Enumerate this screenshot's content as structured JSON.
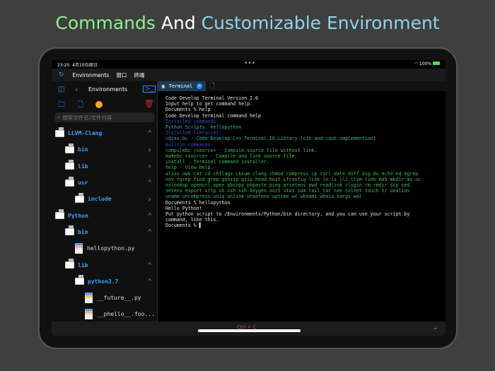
{
  "headline": {
    "part1": "Commands",
    "part2": "And",
    "part3": "Customizable Environment"
  },
  "status": {
    "time": "23:20",
    "date": "4月10日周日",
    "battery": "100%"
  },
  "menu": {
    "items": [
      "Environments",
      "窗口",
      "终端"
    ]
  },
  "sidebar": {
    "title": "Environments",
    "search_placeholder": "搜索文件名/文件内容",
    "tree": [
      {
        "name": "LLVM-Clang",
        "type": "dir",
        "level": 0,
        "chevron": "up"
      },
      {
        "name": "bin",
        "type": "dir",
        "level": 1,
        "chevron": "right"
      },
      {
        "name": "lib",
        "type": "dir",
        "level": 1,
        "chevron": "right"
      },
      {
        "name": "usr",
        "type": "dir",
        "level": 1,
        "chevron": "up"
      },
      {
        "name": "include",
        "type": "dir",
        "level": 2,
        "chevron": "right"
      },
      {
        "name": "Python",
        "type": "dir",
        "level": 0,
        "chevron": "up"
      },
      {
        "name": "bin",
        "type": "dir",
        "level": 1,
        "chevron": "up"
      },
      {
        "name": "hellopython.py",
        "type": "file",
        "level": 2
      },
      {
        "name": "lib",
        "type": "dir",
        "level": 1,
        "chevron": "up"
      },
      {
        "name": "python3.7",
        "type": "dir",
        "level": 2,
        "chevron": "up"
      },
      {
        "name": "__future__.py",
        "type": "file",
        "level": 3
      },
      {
        "name": "__phello__.foo...",
        "type": "file",
        "level": 3
      }
    ]
  },
  "terminal": {
    "tab_label": "Terminal",
    "lines": [
      {
        "t": "Code Develop Terminal Version 2.0",
        "c": "#e8e8e8"
      },
      {
        "t": "Input help to get command help.",
        "c": "#e8e8e8"
      },
      {
        "t": "Documents % help",
        "c": "#e8e8e8"
      },
      {
        "t": "Code Develop terminal command help",
        "c": "#e8e8e8"
      },
      {
        "t": "Installed commands:",
        "c": "#3d4fc9"
      },
      {
        "t": "Python Scripts: hellopython",
        "c": "#2fb9b0"
      },
      {
        "t": "Installed libraries:",
        "c": "#3d4fc9"
      },
      {
        "t": "cdcxx.bc - Code Develop C++ Terminal IO Library (cin and cout implemention)",
        "c": "#2fb9b0"
      },
      {
        "t": "Builtin commands:",
        "c": "#3d4fc9"
      },
      {
        "t": "compilebc <source> - Compile source file without link.",
        "c": "#3fbf5a"
      },
      {
        "t": "makebc <source> - Compile and link source file.",
        "c": "#3fbf5a"
      },
      {
        "t": "install - Terminal command installer.",
        "c": "#3fbf5a"
      },
      {
        "t": "help - View help.",
        "c": "#3fbf5a"
      },
      {
        "t": "alias awk cat cd chflags cksum clang chmod compress cp curl date diff dig du echo ed egrep",
        "c": "#3fbf5a"
      },
      {
        "t": "env fgrep find grep gunzip gzip head host ifconfig link ln ls lli llvm-link md5 mkdir mv nc",
        "c": "#3fbf5a"
      },
      {
        "t": "nslookup openurl open pbcopy pbpaste ping printenv pwd readlink rlogin rm rmdir scp sed",
        "c": "#3fbf5a"
      },
      {
        "t": "setenv export sftp sh ssh ssh-keygen sort stat sum tail tar tee telnet touch tr unalias",
        "c": "#3fbf5a"
      },
      {
        "t": "uname uncompress uniq unlink unsetenv uptime wc whoami whois xargs wol",
        "c": "#3fbf5a"
      },
      {
        "t": "Documents % hellopython",
        "c": "#e8e8e8"
      },
      {
        "t": "Hello Python!",
        "c": "#e8e8e8"
      },
      {
        "t": "Put python script to /Environments/Python/bin directory, and you can use your script by",
        "c": "#e8e8e8"
      },
      {
        "t": "command, like this.",
        "c": "#e8e8e8"
      },
      {
        "t": "Documents % ▌",
        "c": "#e8e8e8"
      }
    ]
  },
  "bottom": {
    "ctrl_c": "Ctrl + C"
  }
}
